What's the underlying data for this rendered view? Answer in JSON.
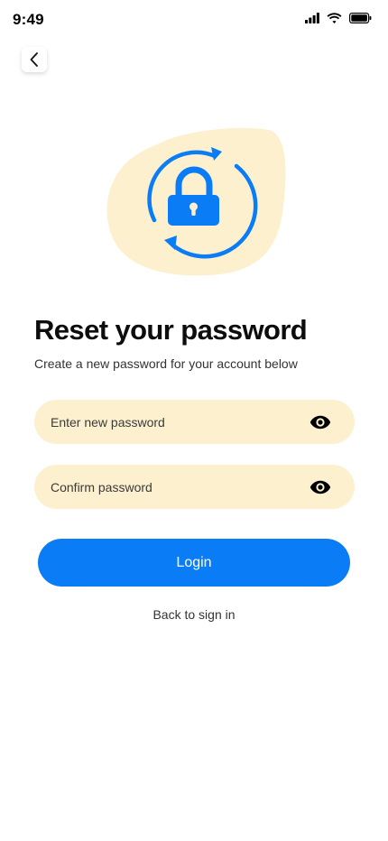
{
  "status_bar": {
    "time": "9:49",
    "icons": [
      "signal-icon",
      "wifi-icon",
      "battery-icon"
    ]
  },
  "header": {
    "back_icon": "chevron-left-icon"
  },
  "illustration": {
    "icon": "lock-refresh-icon",
    "colors": {
      "blob": "#fdf0cf",
      "accent": "#0a7cf5"
    }
  },
  "content": {
    "title": "Reset your password",
    "subtitle": "Create a new password for your account below"
  },
  "form": {
    "new_password_placeholder": "Enter new password",
    "confirm_password_placeholder": "Confirm password",
    "eye_icon": "eye-icon"
  },
  "actions": {
    "login_label": "Login",
    "back_to_sign_in": "Back to sign in"
  },
  "colors": {
    "primary": "#0a7cf5",
    "input_background": "#fdf0cf",
    "text": "#0d0d0d"
  }
}
